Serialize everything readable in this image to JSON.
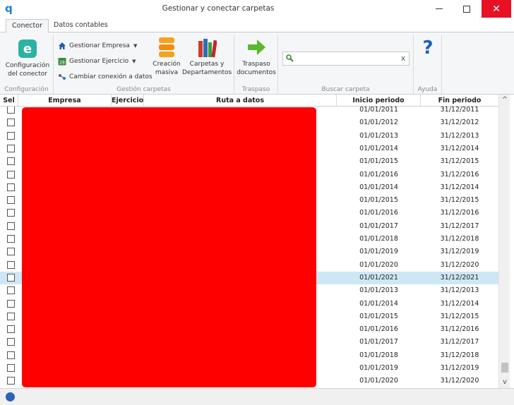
{
  "window": {
    "app_icon": "q",
    "title": "Gestionar y conectar carpetas",
    "close_glyph": "✕"
  },
  "tabs": [
    {
      "label": "Conector",
      "active": true
    },
    {
      "label": "Datos contables",
      "active": false
    }
  ],
  "ribbon": {
    "configuracion": {
      "icon_letter": "e",
      "button_label_1": "Configuración",
      "button_label_2": "del conector",
      "group_label": "Configuración"
    },
    "gestion": {
      "empresa_label": "Gestionar Empresa",
      "ejercicio_label": "Gestionar Ejercicio",
      "ejercicio_icon_text": "28",
      "cambiar_label": "Cambiar conexión a datos",
      "creacion_1": "Creación",
      "creacion_2": "masiva",
      "carpetas_1": "Carpetas y",
      "carpetas_2": "Departamentos",
      "group_label": "Gestión carpetas"
    },
    "traspaso": {
      "button_1": "Traspaso",
      "button_2": "documentos",
      "group_label": "Traspaso"
    },
    "buscar": {
      "search_value": "",
      "clear_glyph": "x",
      "group_label": "Buscar carpeta"
    },
    "ayuda": {
      "help_glyph": "?",
      "group_label": "Ayuda"
    }
  },
  "grid": {
    "headers": {
      "sel": "Sel",
      "empresa": "Empresa",
      "ejercicio": "Ejercicio",
      "ruta": "Ruta a datos",
      "inicio": "Inicio periodo",
      "fin": "Fin periodo"
    },
    "selected_row_index": 13,
    "rows": [
      {
        "inicio": "01/01/2011",
        "fin": "31/12/2011"
      },
      {
        "inicio": "01/01/2012",
        "fin": "31/12/2012"
      },
      {
        "inicio": "01/01/2013",
        "fin": "31/12/2013"
      },
      {
        "inicio": "01/01/2014",
        "fin": "31/12/2014"
      },
      {
        "inicio": "01/01/2015",
        "fin": "31/12/2015"
      },
      {
        "inicio": "01/01/2016",
        "fin": "31/12/2016"
      },
      {
        "inicio": "01/01/2014",
        "fin": "31/12/2014"
      },
      {
        "inicio": "01/01/2015",
        "fin": "31/12/2015"
      },
      {
        "inicio": "01/01/2016",
        "fin": "31/12/2016"
      },
      {
        "inicio": "01/01/2017",
        "fin": "31/12/2017"
      },
      {
        "inicio": "01/01/2018",
        "fin": "31/12/2018"
      },
      {
        "inicio": "01/01/2019",
        "fin": "31/12/2019"
      },
      {
        "inicio": "01/01/2020",
        "fin": "31/12/2020"
      },
      {
        "inicio": "01/01/2021",
        "fin": "31/12/2021"
      },
      {
        "inicio": "01/01/2013",
        "fin": "31/12/2013"
      },
      {
        "inicio": "01/01/2014",
        "fin": "31/12/2014"
      },
      {
        "inicio": "01/01/2015",
        "fin": "31/12/2015"
      },
      {
        "inicio": "01/01/2016",
        "fin": "31/12/2016"
      },
      {
        "inicio": "01/01/2017",
        "fin": "31/12/2017"
      },
      {
        "inicio": "01/01/2018",
        "fin": "31/12/2018"
      },
      {
        "inicio": "01/01/2019",
        "fin": "31/12/2019"
      },
      {
        "inicio": "01/01/2020",
        "fin": "31/12/2020"
      }
    ]
  },
  "scrollbar": {
    "up_glyph": "^",
    "down_glyph": "v"
  },
  "colors": {
    "redaction": "#ff0000",
    "selected_row": "#cde8f5",
    "close_button": "#e81123"
  }
}
